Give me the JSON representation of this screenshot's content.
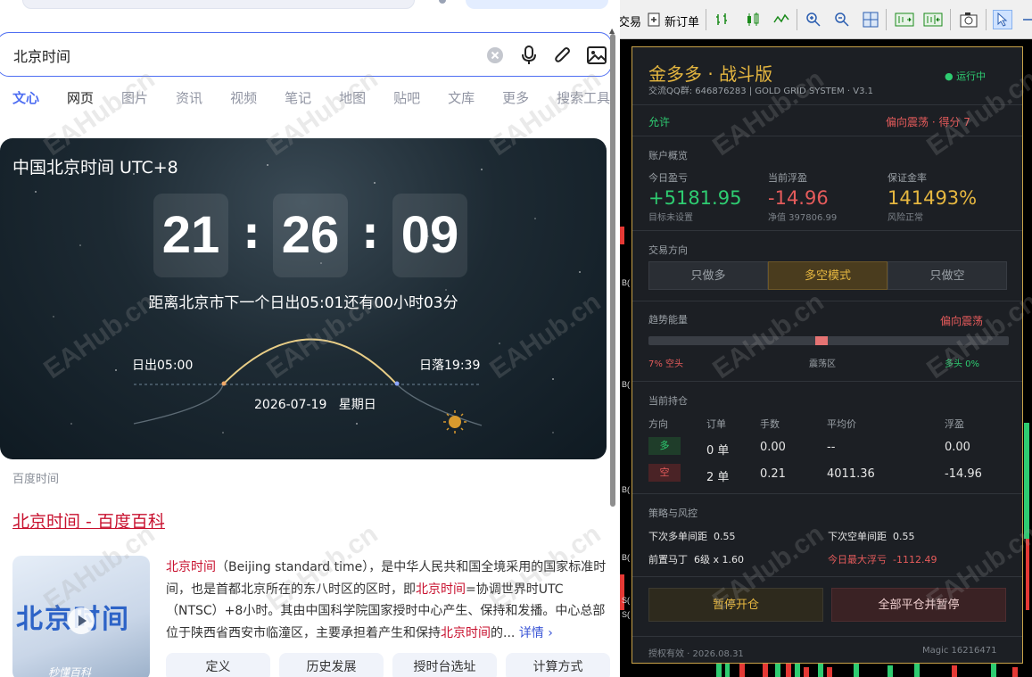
{
  "search": {
    "query": "北京时间",
    "tabs": [
      "文心",
      "网页",
      "图片",
      "资讯",
      "视频",
      "笔记",
      "地图",
      "贴吧",
      "文库",
      "更多",
      "搜索工具"
    ]
  },
  "clock_card": {
    "title": "中国北京时间 UTC+8",
    "hours": "21",
    "minutes": "26",
    "seconds": "09",
    "separator": ":",
    "sunrise_message": "距离北京市下一个日出05:01还有00小时03分",
    "sunrise": "日出05:00",
    "sunset": "日落19:39",
    "date": "2026-07-19",
    "weekday": "星期日",
    "source": "百度时间"
  },
  "result": {
    "title": "北京时间 - 百度百科",
    "thumb_text": "北京时间",
    "thumb_caption": "秒懂百科",
    "body_parts": [
      {
        "t": "北京时间",
        "hl": true
      },
      {
        "t": "（Beijing standard time），是中华人民共和国全境采用的国家标准时间，也是首都北京所在的东八时区的区时，即",
        "hl": false
      },
      {
        "t": "北京时间",
        "hl": true
      },
      {
        "t": "=协调世界时UTC（NTSC）+8小时。其由中国科学院国家授时中心产生、保持和发播。中心总部位于陕西省西安市临潼区，主要承担着产生和保持",
        "hl": false
      },
      {
        "t": "北京时间",
        "hl": true
      },
      {
        "t": "的...",
        "hl": false
      }
    ],
    "more_link": "详情",
    "chips": [
      "定义",
      "历史发展",
      "授时台选址",
      "计算方式"
    ]
  },
  "terminal": {
    "toolbar_partial": "交易",
    "new_order": "新订单",
    "axis_labels": [
      "B(",
      "B(",
      "B(",
      "B(",
      "S(",
      "S("
    ]
  },
  "panel": {
    "title": "金多多 · 战斗版",
    "subtitle": "交流QQ群: 646876283  |  GOLD GRID SYSTEM · V3.1",
    "status": "● 运行中",
    "permission": "允许",
    "bias": "偏向震荡 · 得分 7",
    "account_section": "账户概览",
    "today_pnl_label": "今日盈亏",
    "today_pnl": "+5181.95",
    "today_pnl_note": "目标未设置",
    "floating_label": "当前浮盈",
    "floating": "-14.96",
    "net_value": "净值 397806.99",
    "margin_label": "保证金率",
    "margin": "141493%",
    "margin_note": "风险正常",
    "direction_section": "交易方向",
    "direction_options": [
      "只做多",
      "多空模式",
      "只做空"
    ],
    "direction_selected": 1,
    "trend_section": "趋势能量",
    "trend_state": "偏向震荡",
    "trend_left": "7% 空头",
    "trend_mid": "震荡区",
    "trend_right": "多头 0%",
    "trend_marker": 0.48,
    "positions_section": "当前持仓",
    "pos_headers": [
      "方向",
      "订单",
      "手数",
      "平均价",
      "浮盈"
    ],
    "positions": [
      {
        "dir": "多",
        "orders": "0 单",
        "lots": "0.00",
        "avg": "--",
        "pnl": "0.00",
        "dir_color": "#2ecc71",
        "pnl_color": "#2ecc71"
      },
      {
        "dir": "空",
        "orders": "2 单",
        "lots": "0.21",
        "avg": "4011.36",
        "pnl": "-14.96",
        "dir_color": "#e55b5b",
        "pnl_color": "#e55b5b"
      }
    ],
    "strategy_section": "策略与风控",
    "next_buy_label": "下次多单间距",
    "next_buy": "0.55",
    "next_sell_label": "下次空单间距",
    "next_sell": "0.55",
    "martin_label": "前置马丁",
    "martin": "6级 x 1.60",
    "max_float_label": "今日最大浮亏",
    "max_float": "-1112.49",
    "btn_pause": "暂停开仓",
    "btn_close_all": "全部平仓并暂停",
    "license": "授权有效 · 2026.08.31",
    "magic": "Magic 16216471"
  },
  "watermark": "EAHub.cn"
}
